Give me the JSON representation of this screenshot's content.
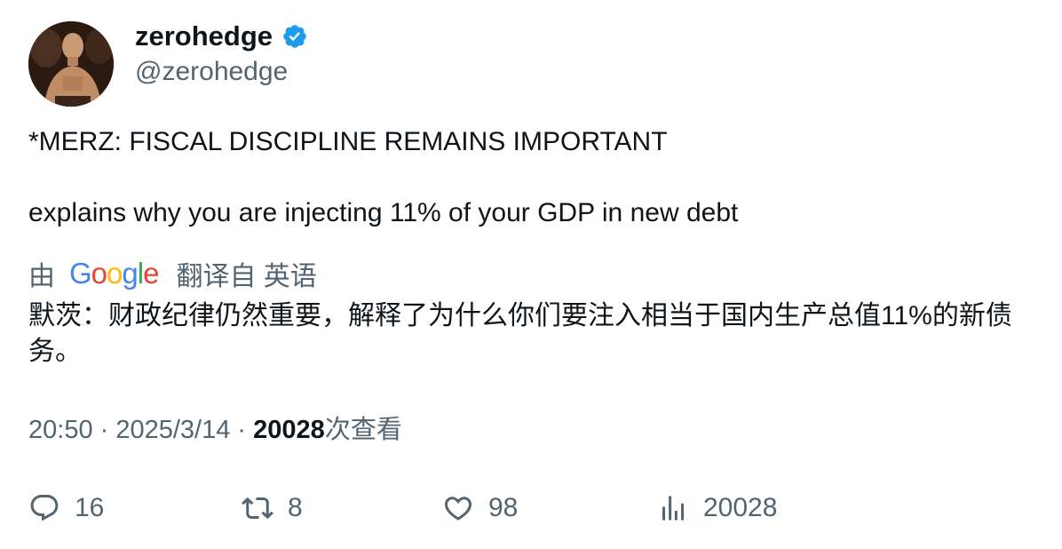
{
  "user": {
    "display_name": "zerohedge",
    "handle": "@zerohedge",
    "verified_icon": "verified-badge-icon",
    "verified_color": "#1D9BF0"
  },
  "tweet": {
    "line1": "*MERZ: FISCAL DISCIPLINE REMAINS IMPORTANT",
    "line2": "explains why you are injecting 11% of your GDP in new debt"
  },
  "translation": {
    "by_label": "由",
    "provider": "Google",
    "from_label": "翻译自 英语",
    "text": "默茨：财政纪律仍然重要，解释了为什么你们要注入相当于国内生产总值11%的新债务。"
  },
  "meta": {
    "time": "20:50",
    "separator": " · ",
    "date": "2025/3/14",
    "views_count": "20028",
    "views_label": "次查看"
  },
  "actions": {
    "reply_count": "16",
    "retweet_count": "8",
    "like_count": "98",
    "views_count": "20028"
  },
  "colors": {
    "text_primary": "#0f1419",
    "text_secondary": "#536471"
  }
}
